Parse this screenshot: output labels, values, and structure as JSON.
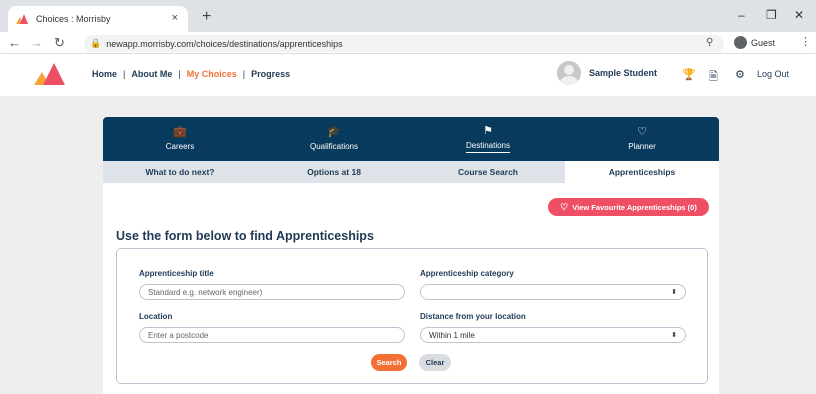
{
  "browser": {
    "tab_title": "Choices : Morrisby",
    "tab_close": "×",
    "new_tab": "+",
    "url": "newapp.morrisby.com/choices/destinations/apprenticeships",
    "profile": "Guest",
    "window_controls": [
      "–",
      "❐",
      "✕"
    ]
  },
  "header": {
    "nav": [
      "Home",
      "About Me",
      "My Choices",
      "Progress"
    ],
    "active_nav": "My Choices",
    "user_name": "Sample Student",
    "logout": "Log Out",
    "brand_colors": {
      "navy": "#083a5d",
      "orange": "#f46f36",
      "pink": "#ef4f64"
    }
  },
  "categories": [
    {
      "label": "Careers",
      "icon": "briefcase-icon"
    },
    {
      "label": "Qualifications",
      "icon": "graduation-cap-icon"
    },
    {
      "label": "Destinations",
      "icon": "signpost-icon",
      "active": true
    },
    {
      "label": "Planner",
      "icon": "heart-icon"
    }
  ],
  "subtabs": [
    "What to do next?",
    "Options at 18",
    "Course Search",
    "Apprenticeships"
  ],
  "active_subtab": "Apprenticeships",
  "favourites_button": "View Favourite Apprenticeships (0)",
  "form": {
    "title": "Use the form below to find Apprenticeships",
    "title_label": "Apprenticeship title",
    "title_placeholder": "Standard e.g. network engineer)",
    "category_label": "Apprenticeship category",
    "category_value": "",
    "location_label": "Location",
    "location_placeholder": "Enter a postcode",
    "distance_label": "Distance from your location",
    "distance_value": "Within 1 mile",
    "search_button": "Search",
    "clear_button": "Clear"
  }
}
